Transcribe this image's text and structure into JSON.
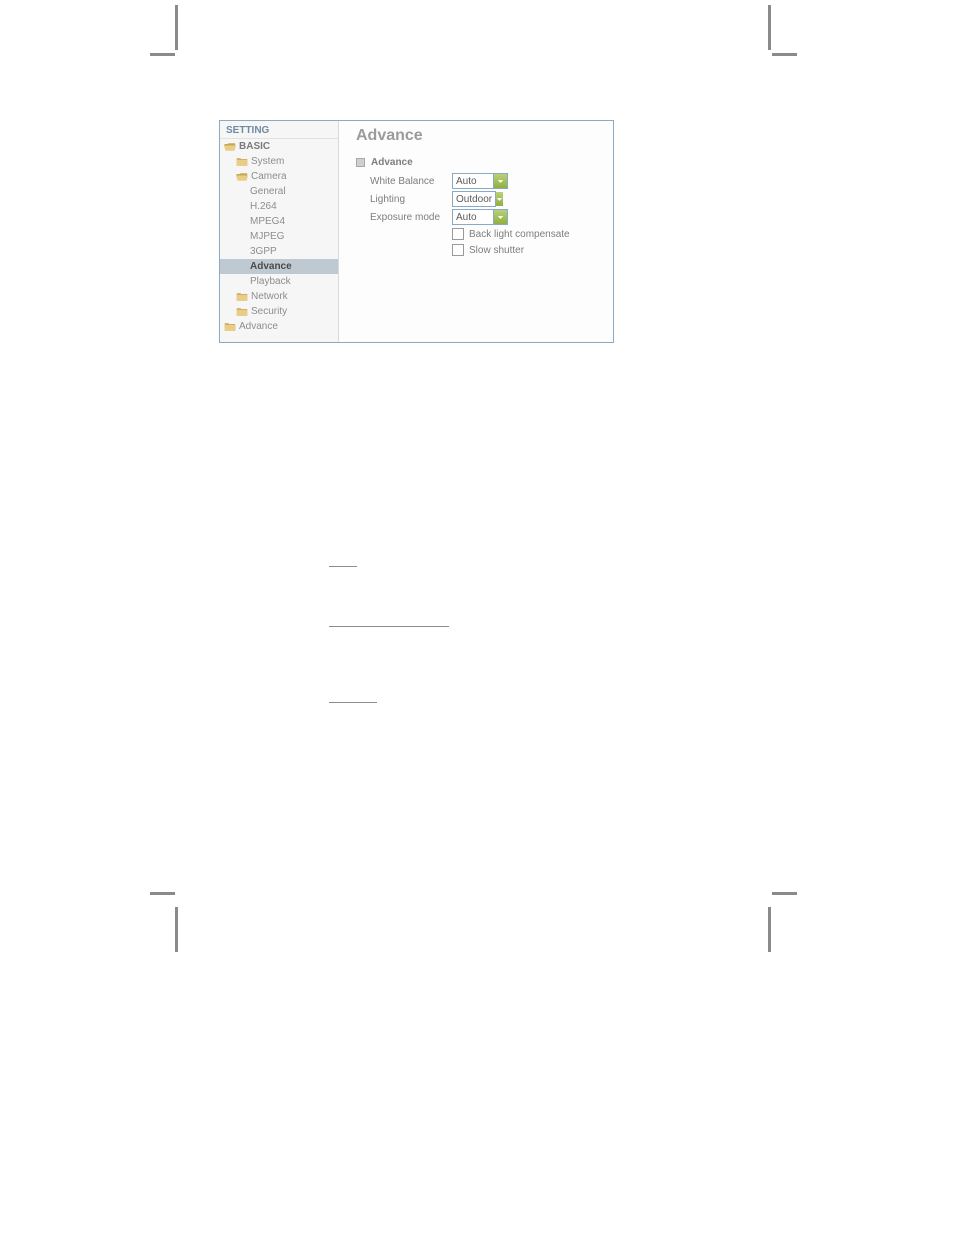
{
  "sidebar": {
    "title": "SETTING",
    "basic_label": "BASIC",
    "items": {
      "system": "System",
      "camera": "Camera",
      "general": "General",
      "h264": "H.264",
      "mpeg4": "MPEG4",
      "mjpeg": "MJPEG",
      "gpp": "3GPP",
      "advance": "Advance",
      "playback": "Playback",
      "network": "Network",
      "security": "Security",
      "advance_root": "Advance"
    }
  },
  "main": {
    "title": "Advance",
    "section": "Advance",
    "white_balance": {
      "label": "White Balance",
      "value": "Auto"
    },
    "lighting": {
      "label": "Lighting",
      "value": "Outdoor"
    },
    "exposure": {
      "label": "Exposure mode",
      "value": "Auto"
    },
    "backlight_label": "Back light compensate",
    "slow_shutter_label": "Slow shutter"
  }
}
